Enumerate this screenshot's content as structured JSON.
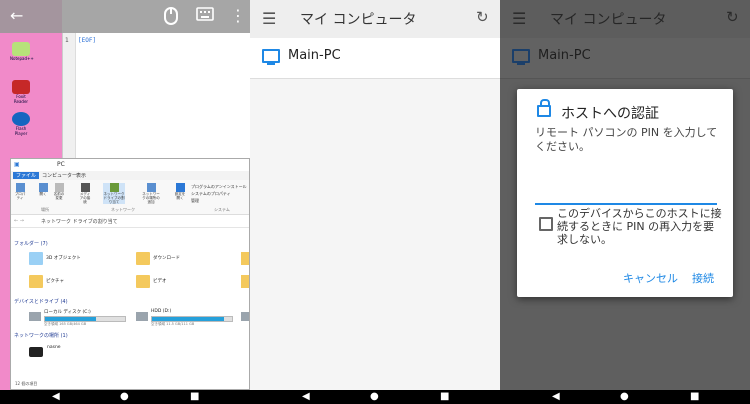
{
  "remote": {
    "notepad": {
      "line_number": "1",
      "eof_marker": "[EOF]"
    },
    "desktop_icons": [
      {
        "label": "Notepad++"
      },
      {
        "label": "Foxit Reader"
      },
      {
        "label": "Flash Player"
      }
    ],
    "explorer": {
      "title": "PC",
      "tabs": [
        "ファイル",
        "コンピューター",
        "表示"
      ],
      "ribbon_buttons": [
        "プロパティ",
        "開く",
        "名前の変更",
        "メディアの接続",
        "ネットワークドライブの割り当て",
        "ネットワークの場所の追加",
        "設定を開く"
      ],
      "ribbon_right": [
        "プログラムのアンインストール",
        "システムのプロパティ",
        "管理"
      ],
      "groups": [
        "場所",
        "ネットワーク",
        "システム"
      ],
      "address": "ネットワーク ドライブの割り当て",
      "folders_header": "フォルダー (7)",
      "folders": [
        "3D オブジェクト",
        "ダウンロード",
        "ピクチャ",
        "ビデオ"
      ],
      "drives_header": "デバイスとドライブ (4)",
      "drives": [
        {
          "label": "ローカル ディスク (C:)",
          "capacity": "空き領域 165 GB/464 GB",
          "used_fraction": 0.64
        },
        {
          "label": "HDD (D:)",
          "capacity": "空き領域 11.5 GB/111 GB",
          "used_fraction": 0.9
        }
      ],
      "network_header": "ネットワークの場所 (1)",
      "network_item": "nasne",
      "status": "12 個の項目"
    }
  },
  "appbar": {
    "title": "マイ コンピュータ"
  },
  "computers": [
    {
      "name": "Main-PC"
    }
  ],
  "dialog": {
    "title": "ホストへの認証",
    "message": "リモート パソコンの PIN を入力してください。",
    "pin_value": "",
    "checkbox_label": "このデバイスからこのホストに接続するときに PIN の再入力を要求しない。",
    "checkbox_checked": false,
    "cancel": "キャンセル",
    "connect": "接続"
  },
  "colors": {
    "accent": "#1e88e5",
    "desktop": "#f18ac9"
  },
  "icons": [
    "back-arrow-icon",
    "mouse-icon",
    "keyboard-icon",
    "more-vert-icon",
    "hamburger-menu-icon",
    "refresh-icon",
    "monitor-icon",
    "lock-icon",
    "nav-back-icon",
    "nav-home-icon",
    "nav-recents-icon"
  ]
}
